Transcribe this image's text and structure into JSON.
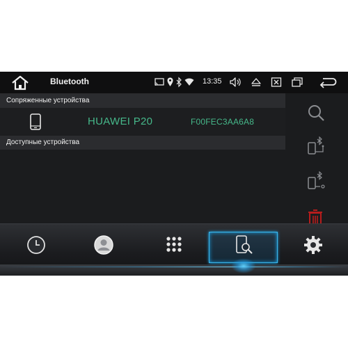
{
  "statusbar": {
    "title": "Bluetooth",
    "time": "13:35",
    "icons": [
      "home-icon",
      "cast-icon",
      "location-icon",
      "bluetooth-icon",
      "wifi-icon",
      "volume-icon",
      "eject-icon",
      "close-window-icon",
      "recent-apps-icon",
      "back-icon"
    ]
  },
  "paired": {
    "header": "Сопряженные устройства",
    "devices": [
      {
        "name": "HUAWEI P20",
        "mac": "F00FEC3AA6A8",
        "icon": "phone-icon"
      }
    ]
  },
  "available": {
    "header": "Доступные устройства"
  },
  "right_panel": {
    "buttons": [
      "search-icon",
      "phone-bluetooth-connect-icon",
      "phone-bluetooth-disconnect-icon",
      "trash-icon"
    ]
  },
  "dock": {
    "buttons": [
      "clock-icon",
      "contacts-icon",
      "dialpad-icon",
      "phone-search-icon",
      "settings-gear-icon"
    ],
    "active_index": 3
  },
  "colors": {
    "accent": "#3cb7ea",
    "device_text": "#46b88a",
    "delete": "#b71c1c"
  }
}
